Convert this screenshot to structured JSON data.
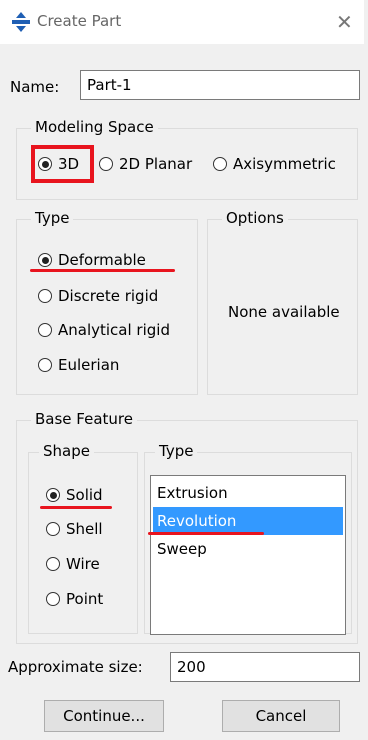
{
  "window": {
    "title": "Create Part",
    "close_glyph": "✕"
  },
  "name": {
    "label": "Name:",
    "value": "Part-1"
  },
  "modeling_space": {
    "legend": "Modeling Space",
    "options": [
      {
        "label": "3D",
        "selected": true
      },
      {
        "label": "2D Planar",
        "selected": false
      },
      {
        "label": "Axisymmetric",
        "selected": false
      }
    ]
  },
  "type": {
    "legend": "Type",
    "options": [
      {
        "label": "Deformable",
        "selected": true
      },
      {
        "label": "Discrete rigid",
        "selected": false
      },
      {
        "label": "Analytical rigid",
        "selected": false
      },
      {
        "label": "Eulerian",
        "selected": false
      }
    ]
  },
  "options": {
    "legend": "Options",
    "text": "None available"
  },
  "base_feature": {
    "legend": "Base Feature",
    "shape": {
      "legend": "Shape",
      "options": [
        {
          "label": "Solid",
          "selected": true
        },
        {
          "label": "Shell",
          "selected": false
        },
        {
          "label": "Wire",
          "selected": false
        },
        {
          "label": "Point",
          "selected": false
        }
      ]
    },
    "type": {
      "legend": "Type",
      "items": [
        {
          "label": "Extrusion",
          "selected": false
        },
        {
          "label": "Revolution",
          "selected": true
        },
        {
          "label": "Sweep",
          "selected": false
        }
      ]
    }
  },
  "approx_size": {
    "label": "Approximate size:",
    "value": "200"
  },
  "buttons": {
    "continue": "Continue...",
    "cancel": "Cancel"
  },
  "colors": {
    "annotation_red": "#e8141e",
    "selection_blue": "#3399ff"
  }
}
